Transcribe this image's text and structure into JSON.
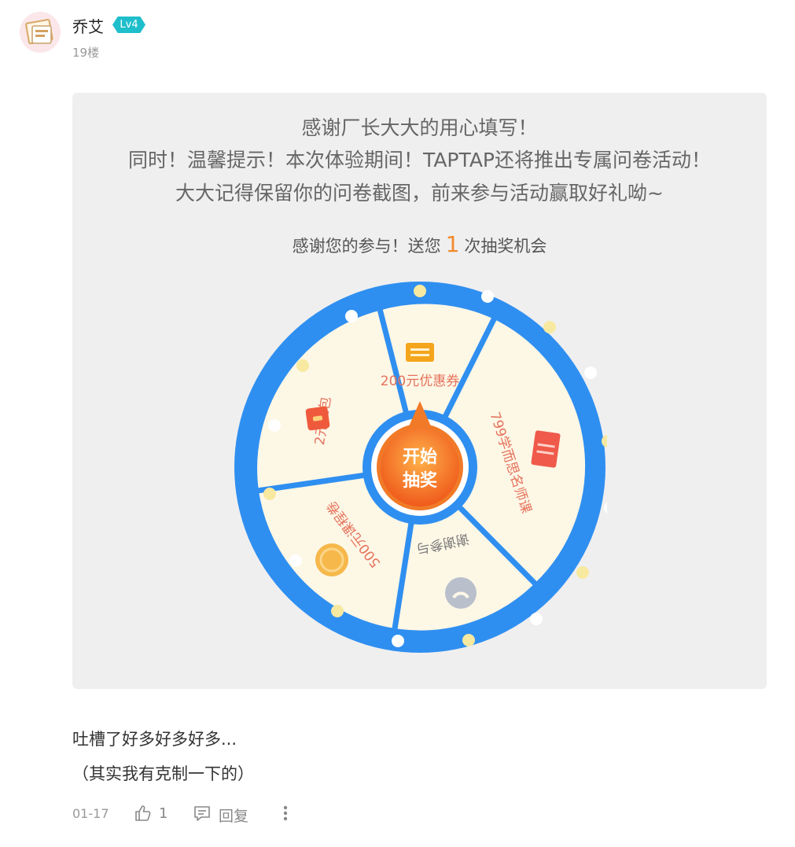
{
  "post": {
    "user": {
      "name": "乔艾",
      "level": "Lv4"
    },
    "floor": "19楼",
    "image": {
      "lines": [
        "感谢厂长大大的用心填写！",
        "同时！温馨提示！本次体验期间！TAPTAP还将推出专属问卷活动！",
        "大大记得保留你的问卷截图，前来参与活动赢取好礼呦~"
      ],
      "lottery": {
        "prefix": "感谢您的参与！送您",
        "count": "1",
        "suffix": "次抽奖机会"
      },
      "wheel": {
        "center_label_1": "开始",
        "center_label_2": "抽奖",
        "prizes": [
          {
            "label": "200元优惠券",
            "icon": "ticket-icon"
          },
          {
            "label": "799学而思名师课",
            "icon": "card-icon"
          },
          {
            "label": "谢谢参与",
            "icon": "sad-face-icon"
          },
          {
            "label": "500元课程卷",
            "icon": "coin-icon"
          },
          {
            "label": "2元红包",
            "icon": "red-envelope-icon"
          }
        ]
      }
    },
    "comment_lines": [
      "吐槽了好多好多好多...",
      "（其实我有克制一下的）"
    ],
    "footer": {
      "date": "01-17",
      "likes": "1",
      "reply_label": "回复"
    }
  },
  "colors": {
    "accent": "#1fbecb",
    "wheel_blue": "#2f8ff0",
    "highlight": "#f28a2b"
  }
}
